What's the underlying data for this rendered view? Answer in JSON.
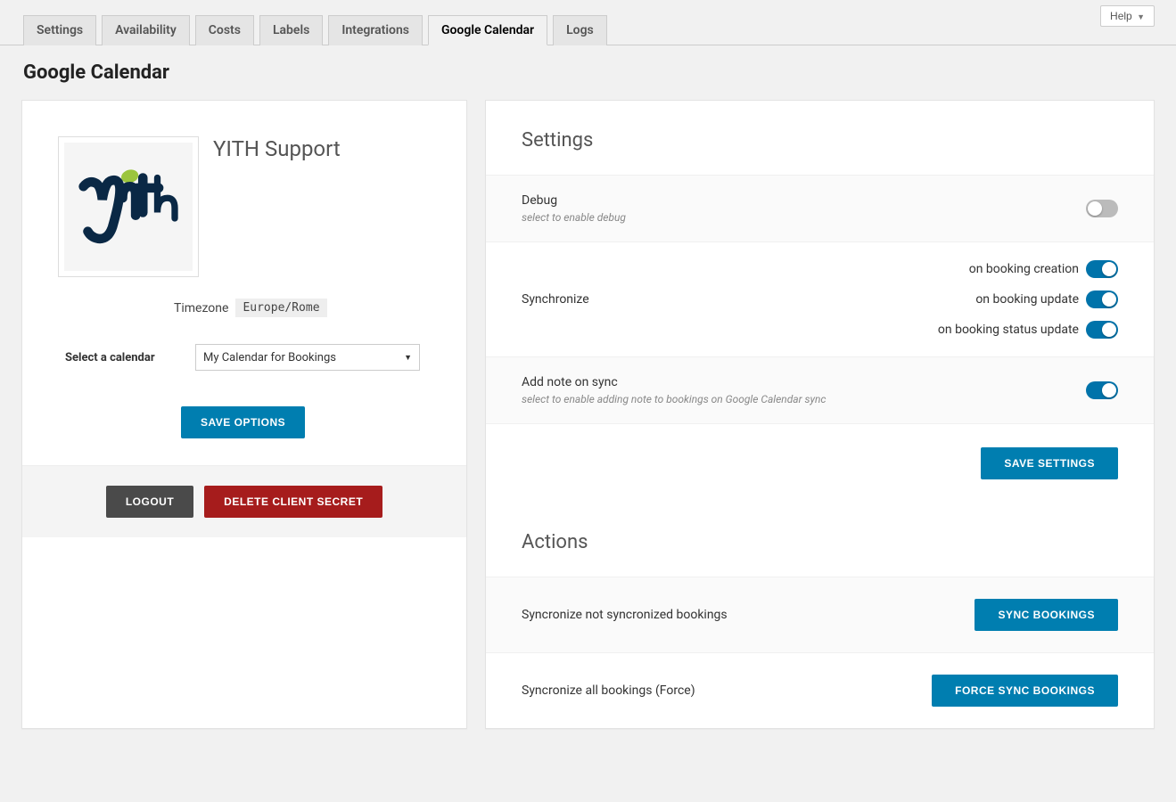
{
  "help_label": "Help",
  "tabs": {
    "settings": "Settings",
    "availability": "Availability",
    "costs": "Costs",
    "labels": "Labels",
    "integrations": "Integrations",
    "google_calendar": "Google Calendar",
    "logs": "Logs"
  },
  "page_title": "Google Calendar",
  "account": {
    "name": "YITH Support",
    "timezone_label": "Timezone",
    "timezone_value": "Europe/Rome",
    "select_calendar_label": "Select a calendar",
    "selected_calendar": "My Calendar for Bookings",
    "save_options": "SAVE OPTIONS",
    "logout": "LOGOUT",
    "delete_secret": "DELETE CLIENT SECRET"
  },
  "settings_section": {
    "heading": "Settings",
    "debug_title": "Debug",
    "debug_desc": "select to enable debug",
    "synchronize_title": "Synchronize",
    "sync_opts": {
      "creation": "on booking creation",
      "update": "on booking update",
      "status": "on booking status update"
    },
    "addnote_title": "Add note on sync",
    "addnote_desc": "select to enable adding note to bookings on Google Calendar sync",
    "save_settings": "SAVE SETTINGS"
  },
  "actions_section": {
    "heading": "Actions",
    "sync_unsynced_label": "Syncronize not syncronized bookings",
    "sync_all_label": "Syncronize all bookings (Force)",
    "sync_bookings_btn": "SYNC BOOKINGS",
    "force_sync_btn": "FORCE SYNC BOOKINGS"
  }
}
